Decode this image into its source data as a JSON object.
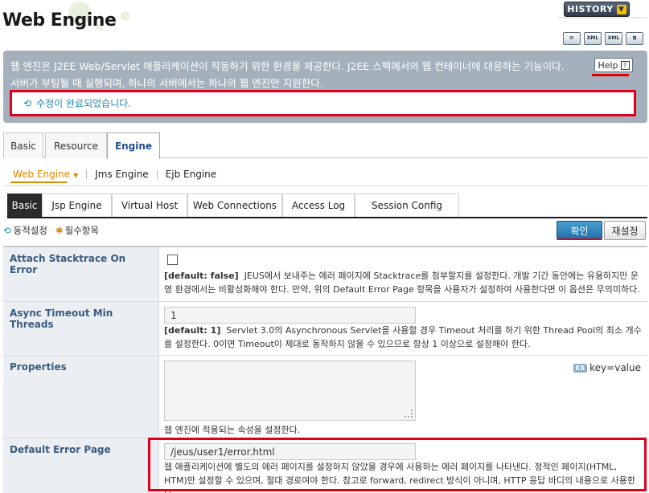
{
  "header": {
    "title": "Web Engine",
    "history_label": "HISTORY",
    "tool_icons": [
      "refresh-icon",
      "xml-export-icon",
      "xml-import-icon",
      "copy-icon"
    ]
  },
  "info": {
    "description": "웹 엔진은 J2EE Web/Servlet 애플리케이션이 작동하기 위한 환경을 제공한다. J2EE 스펙에서의 웹 컨테이너에 대응하는 기능이다. 서버가 부팅될 때 실행되며, 하나의 서버에서는 하나의 웹 엔진만 지원한다.",
    "help_label": "Help",
    "status_message": "수정이 완료되었습니다."
  },
  "tabs": {
    "main": [
      {
        "label": "Basic"
      },
      {
        "label": "Resource"
      },
      {
        "label": "Engine"
      }
    ],
    "engine": [
      {
        "label": "Web Engine"
      },
      {
        "label": "Jms Engine"
      },
      {
        "label": "Ejb Engine"
      }
    ],
    "web": [
      {
        "label": "Basic"
      },
      {
        "label": "Jsp Engine"
      },
      {
        "label": "Virtual Host"
      },
      {
        "label": "Web Connections"
      },
      {
        "label": "Access Log"
      },
      {
        "label": "Session Config"
      }
    ]
  },
  "legend": {
    "dynamic": "동적설정",
    "required": "필수항목"
  },
  "buttons": {
    "confirm": "확인",
    "reset": "재설정"
  },
  "fields": {
    "attach_stacktrace": {
      "label": "Attach Stacktrace On Error",
      "checked": false,
      "default": "[default: false]",
      "description": "JEUS에서 보내주는 에러 페이지에 Stacktrace를 첨부할지를 설정한다. 개발 기간 동안에는 유용하지만 운영 환경에서는 비활성화해야 한다. 만약, 위의 Default Error Page 항목을 사용자가 설정하여 사용한다면 이 옵션은 무의미하다."
    },
    "async_timeout": {
      "label": "Async Timeout Min Threads",
      "value": "1",
      "default": "[default: 1]",
      "description": "Servlet 3.0의 Asynchronous Servlet을 사용할 경우 Timeout 처리를 하기 위한 Thread Pool의 최소 개수를 설정한다. 0이면 Timeout이 제대로 동작하지 않을 수 있으므로 항상 1 이상으로 설정해야 한다."
    },
    "properties": {
      "label": "Properties",
      "value": "",
      "format_badge": "EX",
      "format_hint": "key=value",
      "description": "웹 엔진에 적용되는 속성을 설정한다."
    },
    "default_error_page": {
      "label": "Default Error Page",
      "value": "/jeus/user1/error.html",
      "description": "웹 애플리케이션에 별도의 에러 페이지를 설정하지 않았을 경우에 사용하는 에러 페이지를 나타낸다. 정적인 페이지(HTML, HTM)만 설정할 수 있으며, 절대 경로여야 한다. 참고로 forward, redirect 방식이 아니며, HTTP 응답 바디의 내용으로 사용한다."
    }
  },
  "colors": {
    "accent_blue": "#1b8ab8",
    "highlight_red": "#e0001c",
    "active_orange": "#e08a00",
    "label_bg": "#ebeff3",
    "label_text": "#3a5a7e"
  }
}
